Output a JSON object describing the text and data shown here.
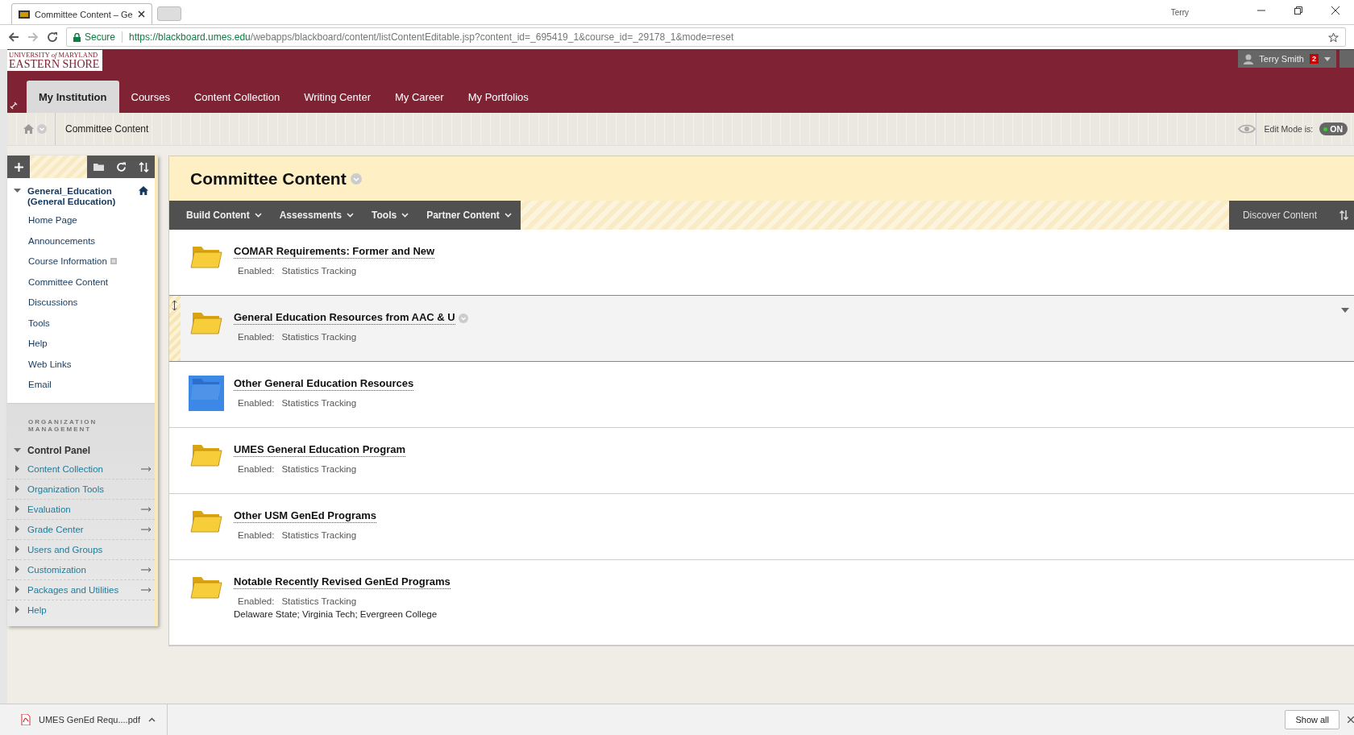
{
  "browser": {
    "tab_title": "Committee Content – Ge",
    "profile": "Terry",
    "secure_label": "Secure",
    "url_host": "https://blackboard.umes.edu",
    "url_path": "/webapps/blackboard/content/listContentEditable.jsp?content_id=_695419_1&course_id=_29178_1&mode=reset"
  },
  "header": {
    "logo_top": "UNIVERSITY *of* MARYLAND",
    "logo_bottom": "EASTERN SHORE",
    "user": "Terry Smith",
    "badge": "2",
    "tabs": [
      {
        "label": "My Institution",
        "selected": true
      },
      {
        "label": "Courses",
        "selected": false
      },
      {
        "label": "Content Collection",
        "selected": false
      },
      {
        "label": "Writing Center",
        "selected": false
      },
      {
        "label": "My Career",
        "selected": false
      },
      {
        "label": "My Portfolios",
        "selected": false
      }
    ]
  },
  "breadcrumb": {
    "current": "Committee Content",
    "edit_mode_label": "Edit Mode is:",
    "edit_mode_value": "ON",
    "edit_mode_on": true
  },
  "sidebar": {
    "course": "General_Education (General Education)",
    "course_expanded": true,
    "items": [
      {
        "label": "Home Page",
        "flag": false
      },
      {
        "label": "Announcements",
        "flag": false
      },
      {
        "label": "Course Information",
        "flag": true
      },
      {
        "label": "Committee Content",
        "flag": false
      },
      {
        "label": "Discussions",
        "flag": false
      },
      {
        "label": "Tools",
        "flag": false
      },
      {
        "label": "Help",
        "flag": false
      },
      {
        "label": "Web Links",
        "flag": false
      },
      {
        "label": "Email",
        "flag": false
      }
    ],
    "section_label": "ORGANIZATION MANAGEMENT",
    "panel_title": "Control Panel",
    "panel_expanded": true,
    "panel_items": [
      {
        "label": "Content Collection",
        "arrow": true
      },
      {
        "label": "Organization Tools",
        "arrow": false
      },
      {
        "label": "Evaluation",
        "arrow": true
      },
      {
        "label": "Grade Center",
        "arrow": true
      },
      {
        "label": "Users and Groups",
        "arrow": false
      },
      {
        "label": "Customization",
        "arrow": true
      },
      {
        "label": "Packages and Utilities",
        "arrow": true
      },
      {
        "label": "Help",
        "arrow": false
      }
    ]
  },
  "content": {
    "title": "Committee Content",
    "menus": [
      "Build Content",
      "Assessments",
      "Tools",
      "Partner Content"
    ],
    "discover": "Discover Content",
    "items": [
      {
        "title": "COMAR Requirements: Former and New",
        "enabled_label": "Enabled:",
        "enabled_value": "Statistics Tracking",
        "hovered": false,
        "icon_selected": false
      },
      {
        "title": "General Education Resources from AAC & U",
        "enabled_label": "Enabled:",
        "enabled_value": "Statistics Tracking",
        "hovered": true,
        "icon_selected": false
      },
      {
        "title": "Other General Education Resources",
        "enabled_label": "Enabled:",
        "enabled_value": "Statistics Tracking",
        "hovered": false,
        "icon_selected": true
      },
      {
        "title": "UMES General Education Program",
        "enabled_label": "Enabled:",
        "enabled_value": "Statistics Tracking",
        "hovered": false,
        "icon_selected": false
      },
      {
        "title": "Other USM GenEd Programs",
        "enabled_label": "Enabled:",
        "enabled_value": "Statistics Tracking",
        "hovered": false,
        "icon_selected": false
      },
      {
        "title": "Notable Recently Revised GenEd Programs",
        "enabled_label": "Enabled:",
        "enabled_value": "Statistics Tracking",
        "hovered": false,
        "icon_selected": false,
        "description": "Delaware State; Virginia Tech; Evergreen College"
      }
    ]
  },
  "downloads": {
    "file": "UMES GenEd Requ....pdf",
    "show_all": "Show all"
  }
}
